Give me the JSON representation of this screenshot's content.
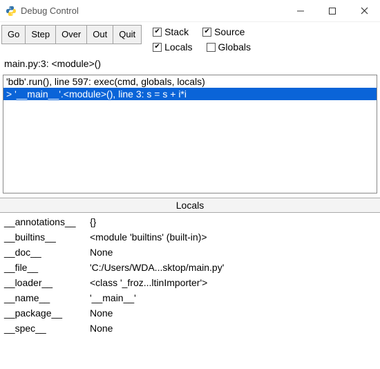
{
  "window": {
    "title": "Debug Control"
  },
  "toolbar": {
    "buttons": {
      "go": "Go",
      "step": "Step",
      "over": "Over",
      "out": "Out",
      "quit": "Quit"
    },
    "checks": {
      "stack": "Stack",
      "source": "Source",
      "locals": "Locals",
      "globals": "Globals"
    }
  },
  "status": "main.py:3: <module>()",
  "stack": {
    "lines": [
      "'bdb'.run(), line 597: exec(cmd, globals, locals)",
      "> '__main__'.<module>(), line 3: s = s + i*i"
    ]
  },
  "locals_header": "Locals",
  "locals": [
    {
      "key": "__annotations__",
      "value": "{}"
    },
    {
      "key": "__builtins__",
      "value": "<module 'builtins' (built-in)>"
    },
    {
      "key": "__doc__",
      "value": "None"
    },
    {
      "key": "__file__",
      "value": "'C:/Users/WDA...sktop/main.py'"
    },
    {
      "key": "__loader__",
      "value": "<class '_froz...ltinImporter'>"
    },
    {
      "key": "__name__",
      "value": "'__main__'"
    },
    {
      "key": "__package__",
      "value": "None"
    },
    {
      "key": "__spec__",
      "value": "None"
    }
  ]
}
